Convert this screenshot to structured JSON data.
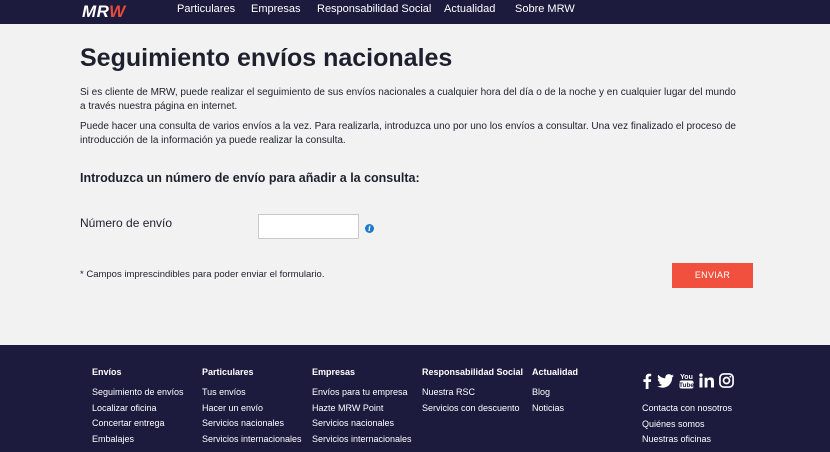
{
  "header": {
    "logo": "MRW",
    "nav": [
      "Particulares",
      "Empresas",
      "Responsabilidad Social",
      "Actualidad",
      "Sobre MRW"
    ]
  },
  "main": {
    "title": "Seguimiento envíos nacionales",
    "paragraph1": "Si es cliente de MRW, puede realizar el seguimiento de sus envíos nacionales a cualquier hora del día o de la noche y en cualquier lugar del mundo a través nuestra página en internet.",
    "paragraph2": "Puede hacer una consulta de varios envíos a la vez. Para realizarla, introduzca uno por uno los envíos a consultar. Una vez finalizado el proceso de introducción de la información ya puede realizar la consulta.",
    "subtitle": "Introduzca un número de envío para añadir a la consulta:",
    "field_label": "Número de envío",
    "field_value": "",
    "required_note": "* Campos imprescindibles para poder enviar el formulario.",
    "send_label": "ENVIAR"
  },
  "footer": {
    "columns": [
      {
        "title": "Envíos",
        "items": [
          "Seguimiento de envíos",
          "Localizar oficina",
          "Concertar entrega",
          "Embalajes"
        ]
      },
      {
        "title": "Particulares",
        "items": [
          "Tus envíos",
          "Hacer un envío",
          "Servicios nacionales",
          "Servicios internacionales"
        ]
      },
      {
        "title": "Empresas",
        "items": [
          "Envíos para tu empresa",
          "Hazte MRW Point",
          "Servicios nacionales",
          "Servicios internacionales"
        ]
      },
      {
        "title": "Responsabilidad Social",
        "items": [
          "Nuestra RSC",
          "Servicios con descuento"
        ]
      },
      {
        "title": "Actualidad",
        "items": [
          "Blog",
          "Noticias"
        ]
      }
    ],
    "social_icons": [
      "facebook-icon",
      "twitter-icon",
      "youtube-icon",
      "linkedin-icon",
      "instagram-icon"
    ],
    "right_links": [
      "Contacta con nosotros",
      "Quiénes somos",
      "Nuestras oficinas"
    ]
  },
  "colors": {
    "navy": "#1c1a3d",
    "accent_red": "#f1503e",
    "background": "#f2f2f2",
    "info_blue": "#1f7ac9"
  }
}
